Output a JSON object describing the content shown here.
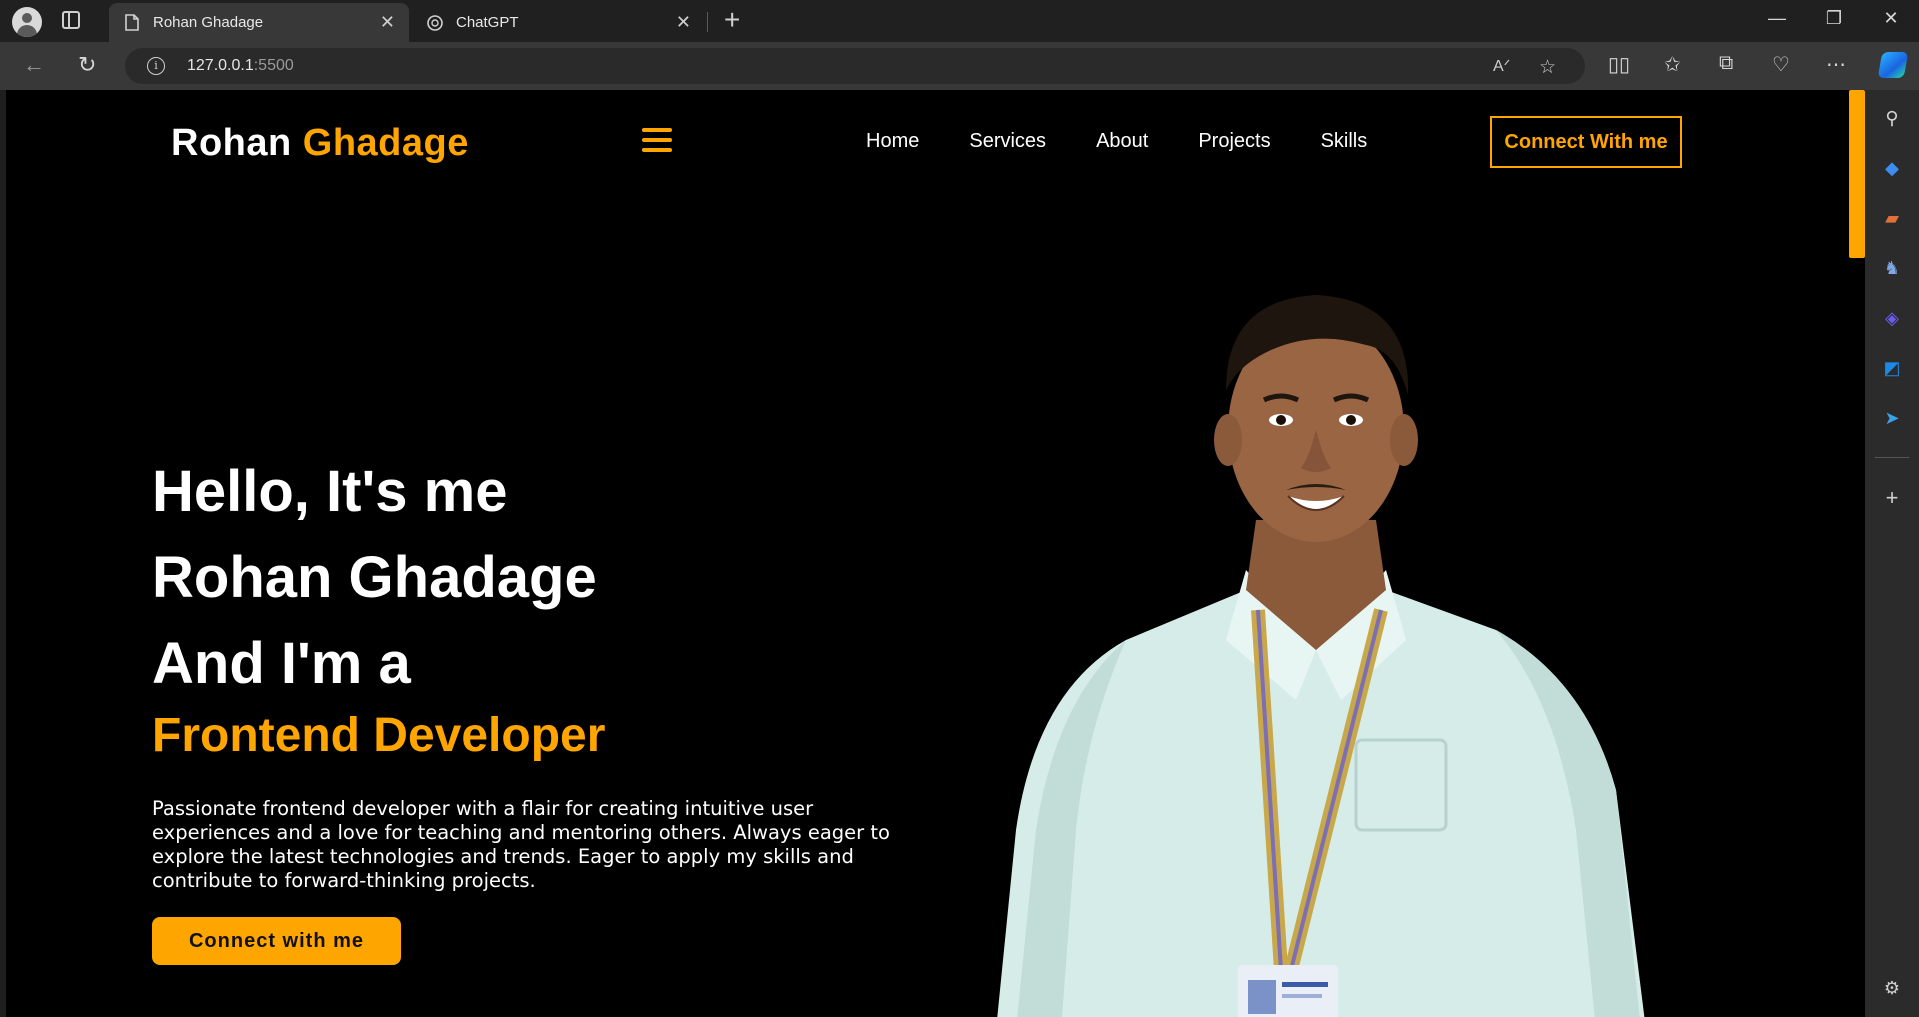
{
  "browser": {
    "tabs": [
      {
        "title": "Rohan Ghadage",
        "icon": "page-icon",
        "active": true
      },
      {
        "title": "ChatGPT",
        "icon": "chatgpt-icon",
        "active": false
      }
    ],
    "new_tab": "+",
    "url_host": "127.0.0.1",
    "url_port": ":5500",
    "window_controls": {
      "minimize": "—",
      "restore": "❐",
      "close": "✕"
    }
  },
  "site": {
    "logo": {
      "first": "Rohan",
      "second": "Ghadage"
    },
    "nav": [
      "Home",
      "Services",
      "About",
      "Projects",
      "Skills"
    ],
    "connect_top": "Connect With me",
    "hero": {
      "line1": "Hello, It's me",
      "line2": "Rohan Ghadage",
      "line3": "And I'm a",
      "role": "Frontend Developer",
      "description": "Passionate frontend developer with a flair for creating intuitive user experiences and a love for teaching and mentoring others. Always eager to explore the latest technologies and trends. Eager to apply my skills and contribute to forward-thinking projects.",
      "button": "Connect with me"
    }
  },
  "colors": {
    "accent": "#ffa500",
    "page_bg": "#000000"
  }
}
